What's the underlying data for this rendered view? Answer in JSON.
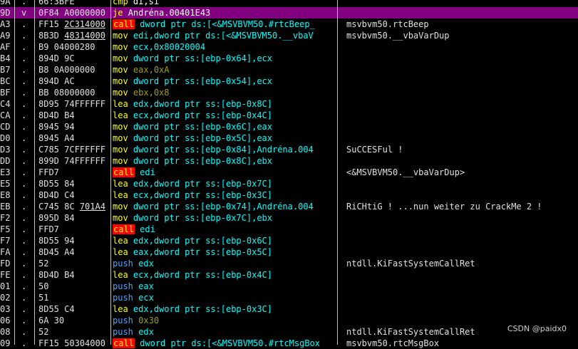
{
  "rows": [
    {
      "addr": "9A",
      "mark": ".",
      "hex": "66:3BFE",
      "hex_u": "",
      "mnem": "cmp",
      "cls": "mov",
      "ops": "di,si",
      "ops_cls": "wh",
      "comment": "",
      "sel": false
    },
    {
      "addr": "9D",
      "mark": "v",
      "hex": "0F84 A0000000",
      "hex_u": "",
      "mnem": "je",
      "cls": "je",
      "ops": "Andréna.00401E43",
      "ops_cls": "sel",
      "comment": "",
      "sel": true
    },
    {
      "addr": "A3",
      "mark": ".",
      "hex": "FF15 ",
      "hex_u": "2C314000",
      "mnem": "call",
      "cls": "call",
      "ops": "dword ptr ds:[<&MSVBVM50.#rtcBeep_",
      "ops_cls": "cy",
      "comment": "msvbvm50.rtcBeep",
      "sel": false
    },
    {
      "addr": "A9",
      "mark": ".",
      "hex": "8B3D ",
      "hex_u": "48314000",
      "mnem": "mov",
      "cls": "mov",
      "ops": "edi,dword ptr ds:[<&MSVBVM50.__vbaV",
      "ops_cls": "cy",
      "comment": "msvbvm50.__vbaVarDup",
      "sel": false
    },
    {
      "addr": "AF",
      "mark": ".",
      "hex": "B9 04000280",
      "hex_u": "",
      "mnem": "mov",
      "cls": "mov",
      "ops": "ecx,0x80020004",
      "ops_cls": "cy",
      "comment": "",
      "sel": false
    },
    {
      "addr": "B4",
      "mark": ".",
      "hex": "894D 9C",
      "hex_u": "",
      "mnem": "mov",
      "cls": "mov",
      "ops": "dword ptr ss:[ebp-0x64],ecx",
      "ops_cls": "cy",
      "comment": "",
      "sel": false
    },
    {
      "addr": "B7",
      "mark": ".",
      "hex": "B8 0A000000",
      "hex_u": "",
      "mnem": "mov",
      "cls": "mov",
      "ops": "eax,0xA",
      "ops_cls": "ol",
      "comment": "",
      "sel": false
    },
    {
      "addr": "BC",
      "mark": ".",
      "hex": "894D AC",
      "hex_u": "",
      "mnem": "mov",
      "cls": "mov",
      "ops": "dword ptr ss:[ebp-0x54],ecx",
      "ops_cls": "cy",
      "comment": "",
      "sel": false
    },
    {
      "addr": "BF",
      "mark": ".",
      "hex": "BB 08000000",
      "hex_u": "",
      "mnem": "mov",
      "cls": "mov",
      "ops": "ebx,0x8",
      "ops_cls": "ol",
      "comment": "",
      "sel": false
    },
    {
      "addr": "C4",
      "mark": ".",
      "hex": "8D95 74FFFFFF",
      "hex_u": "",
      "mnem": "lea",
      "cls": "lea",
      "ops": "edx,dword ptr ss:[ebp-0x8C]",
      "ops_cls": "cy",
      "comment": "",
      "sel": false
    },
    {
      "addr": "CA",
      "mark": ".",
      "hex": "8D4D B4",
      "hex_u": "",
      "mnem": "lea",
      "cls": "lea",
      "ops": "ecx,dword ptr ss:[ebp-0x4C]",
      "ops_cls": "cy",
      "comment": "",
      "sel": false
    },
    {
      "addr": "CD",
      "mark": ".",
      "hex": "8945 94",
      "hex_u": "",
      "mnem": "mov",
      "cls": "mov",
      "ops": "dword ptr ss:[ebp-0x6C],eax",
      "ops_cls": "cy",
      "comment": "",
      "sel": false
    },
    {
      "addr": "D0",
      "mark": ".",
      "hex": "8945 A4",
      "hex_u": "",
      "mnem": "mov",
      "cls": "mov",
      "ops": "dword ptr ss:[ebp-0x5C],eax",
      "ops_cls": "cy",
      "comment": "",
      "sel": false
    },
    {
      "addr": "D3",
      "mark": ".",
      "hex": "C785 7CFFFFFF",
      "hex_u": "",
      "mnem": "mov",
      "cls": "mov",
      "ops": "dword ptr ss:[ebp-0x84],Andréna.004",
      "ops_cls": "cy",
      "comment": "SuCCESFul !",
      "sel": false
    },
    {
      "addr": "DD",
      "mark": ".",
      "hex": "899D 74FFFFFF",
      "hex_u": "",
      "mnem": "mov",
      "cls": "mov",
      "ops": "dword ptr ss:[ebp-0x8C],ebx",
      "ops_cls": "cy",
      "comment": "",
      "sel": false
    },
    {
      "addr": "E3",
      "mark": ".",
      "hex": "FFD7",
      "hex_u": "",
      "mnem": "call",
      "cls": "call",
      "ops": "edi",
      "ops_cls": "cy",
      "comment": "<&MSVBVM50.__vbaVarDup>",
      "sel": false
    },
    {
      "addr": "E5",
      "mark": ".",
      "hex": "8D55 84",
      "hex_u": "",
      "mnem": "lea",
      "cls": "lea",
      "ops": "edx,dword ptr ss:[ebp-0x7C]",
      "ops_cls": "cy",
      "comment": "",
      "sel": false
    },
    {
      "addr": "E8",
      "mark": ".",
      "hex": "8D4D C4",
      "hex_u": "",
      "mnem": "lea",
      "cls": "lea",
      "ops": "ecx,dword ptr ss:[ebp-0x3C]",
      "ops_cls": "cy",
      "comment": "",
      "sel": false
    },
    {
      "addr": "EB",
      "mark": ".",
      "hex": "C745 8C ",
      "hex_u": "701A4",
      "mnem": "mov",
      "cls": "mov",
      "ops": "dword ptr ss:[ebp-0x74],Andréna.004",
      "ops_cls": "cy",
      "comment": "RiCHtiG ! ...nun weiter zu CrackMe 2 !",
      "sel": false
    },
    {
      "addr": "F2",
      "mark": ".",
      "hex": "895D 84",
      "hex_u": "",
      "mnem": "mov",
      "cls": "mov",
      "ops": "dword ptr ss:[ebp-0x7C],ebx",
      "ops_cls": "cy",
      "comment": "",
      "sel": false
    },
    {
      "addr": "F5",
      "mark": ".",
      "hex": "FFD7",
      "hex_u": "",
      "mnem": "call",
      "cls": "call",
      "ops": "edi",
      "ops_cls": "cy",
      "comment": "",
      "sel": false
    },
    {
      "addr": "F7",
      "mark": ".",
      "hex": "8D55 94",
      "hex_u": "",
      "mnem": "lea",
      "cls": "lea",
      "ops": "edx,dword ptr ss:[ebp-0x6C]",
      "ops_cls": "cy",
      "comment": "",
      "sel": false
    },
    {
      "addr": "FA",
      "mark": ".",
      "hex": "8D45 A4",
      "hex_u": "",
      "mnem": "lea",
      "cls": "lea",
      "ops": "eax,dword ptr ss:[ebp-0x5C]",
      "ops_cls": "cy",
      "comment": "",
      "sel": false
    },
    {
      "addr": "FD",
      "mark": ".",
      "hex": "52",
      "hex_u": "",
      "mnem": "push",
      "cls": "push",
      "ops": "edx",
      "ops_cls": "cy",
      "comment": "ntdll.KiFastSystemCallRet",
      "sel": false
    },
    {
      "addr": "FE",
      "mark": ".",
      "hex": "8D4D B4",
      "hex_u": "",
      "mnem": "lea",
      "cls": "lea",
      "ops": "ecx,dword ptr ss:[ebp-0x4C]",
      "ops_cls": "cy",
      "comment": "",
      "sel": false
    },
    {
      "addr": "01",
      "mark": ".",
      "hex": "50",
      "hex_u": "",
      "mnem": "push",
      "cls": "push",
      "ops": "eax",
      "ops_cls": "cy",
      "comment": "",
      "sel": false
    },
    {
      "addr": "02",
      "mark": ".",
      "hex": "51",
      "hex_u": "",
      "mnem": "push",
      "cls": "push",
      "ops": "ecx",
      "ops_cls": "cy",
      "comment": "",
      "sel": false
    },
    {
      "addr": "03",
      "mark": ".",
      "hex": "8D55 C4",
      "hex_u": "",
      "mnem": "lea",
      "cls": "lea",
      "ops": "edx,dword ptr ss:[ebp-0x3C]",
      "ops_cls": "cy",
      "comment": "",
      "sel": false
    },
    {
      "addr": "06",
      "mark": ".",
      "hex": "6A 30",
      "hex_u": "",
      "mnem": "push",
      "cls": "push",
      "ops": "0x30",
      "ops_cls": "ol",
      "comment": "",
      "sel": false
    },
    {
      "addr": "08",
      "mark": ".",
      "hex": "52",
      "hex_u": "",
      "mnem": "push",
      "cls": "push",
      "ops": "edx",
      "ops_cls": "cy",
      "comment": "ntdll.KiFastSystemCallRet",
      "sel": false
    },
    {
      "addr": "09",
      "mark": ".",
      "hex": "FF15 50304000",
      "hex_u": "",
      "mnem": "call",
      "cls": "call",
      "ops": "dword ptr ds:[<&MSVBVM50.#rtcMsgBox",
      "ops_cls": "cy",
      "comment": "msvbvm50.rtcMsgBox",
      "sel": false
    }
  ],
  "watermark": "CSDN @paidx0",
  "colors": {
    "selection": "#800080",
    "call_bg": "#ff0000",
    "mnemonic": "#ffff00",
    "operand": "#00ffff",
    "push": "#4aa3ff"
  }
}
